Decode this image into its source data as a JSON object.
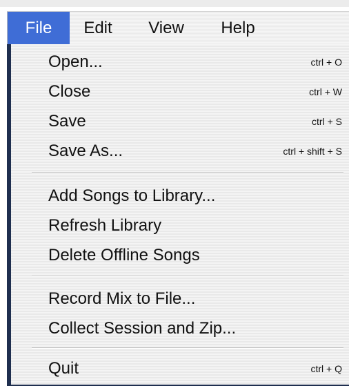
{
  "menubar": {
    "items": [
      {
        "label": "File",
        "active": true
      },
      {
        "label": "Edit",
        "active": false
      },
      {
        "label": "View",
        "active": false
      },
      {
        "label": "Help",
        "active": false
      }
    ]
  },
  "file_menu": {
    "groups": [
      [
        {
          "label": "Open...",
          "shortcut": "ctrl + O"
        },
        {
          "label": "Close",
          "shortcut": "ctrl + W"
        },
        {
          "label": "Save",
          "shortcut": "ctrl + S"
        },
        {
          "label": "Save As...",
          "shortcut": "ctrl + shift + S"
        }
      ],
      [
        {
          "label": "Add Songs to Library...",
          "shortcut": ""
        },
        {
          "label": "Refresh Library",
          "shortcut": ""
        },
        {
          "label": "Delete Offline Songs",
          "shortcut": ""
        }
      ],
      [
        {
          "label": "Record Mix to File...",
          "shortcut": ""
        },
        {
          "label": "Collect Session and Zip...",
          "shortcut": ""
        }
      ],
      [
        {
          "label": "Quit",
          "shortcut": "ctrl + Q"
        }
      ]
    ]
  },
  "colors": {
    "active_menu_background": "#3f6dd6",
    "active_menu_text": "#ffffff",
    "menu_text": "#111111",
    "menu_border": "#1f2f4f"
  }
}
